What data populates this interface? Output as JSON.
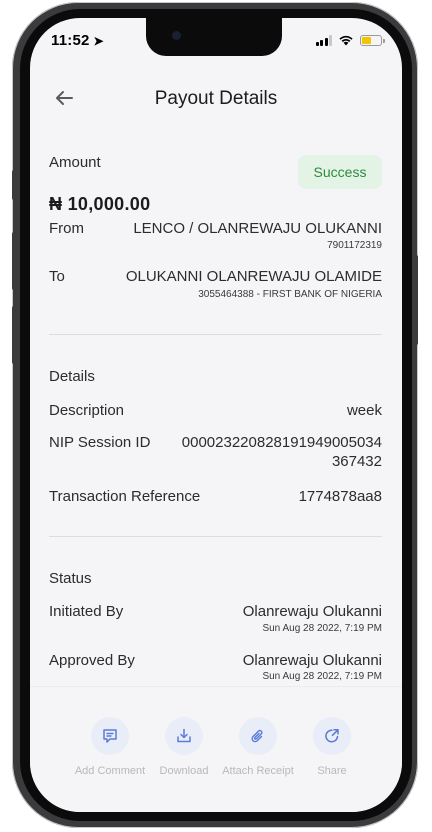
{
  "status_bar": {
    "time": "11:52"
  },
  "header": {
    "title": "Payout Details"
  },
  "amount": {
    "label": "Amount",
    "value": "₦ 10,000.00",
    "status": "Success"
  },
  "from": {
    "label": "From",
    "name": "LENCO / OLANREWAJU OLUKANNI",
    "account": "7901172319"
  },
  "to": {
    "label": "To",
    "name": "OLUKANNI OLANREWAJU OLAMIDE",
    "account": "3055464388 - FIRST BANK OF NIGERIA"
  },
  "details": {
    "heading": "Details",
    "description_label": "Description",
    "description_value": "week",
    "nip_label": "NIP Session ID",
    "nip_value_line1": "000023220828191949005034",
    "nip_value_line2": "367432",
    "reference_label": "Transaction Reference",
    "reference_value": "1774878aa8"
  },
  "status": {
    "heading": "Status",
    "initiated_label": "Initiated By",
    "initiated_name": "Olanrewaju Olukanni",
    "initiated_date": "Sun Aug 28 2022, 7:19 PM",
    "approved_label": "Approved By",
    "approved_name": "Olanrewaju Olukanni",
    "approved_date": "Sun Aug 28 2022, 7:19 PM"
  },
  "actions": [
    {
      "label": "Add Comment",
      "icon": "comment-icon"
    },
    {
      "label": "Download",
      "icon": "download-icon"
    },
    {
      "label": "Attach Receipt",
      "icon": "paperclip-icon"
    },
    {
      "label": "Share",
      "icon": "share-icon"
    }
  ],
  "colors": {
    "success_bg": "#e3f3e6",
    "success_text": "#2e8b3e",
    "action_bg": "#e9edf8",
    "action_icon": "#5b7bd6",
    "battery": "#f5c400"
  }
}
